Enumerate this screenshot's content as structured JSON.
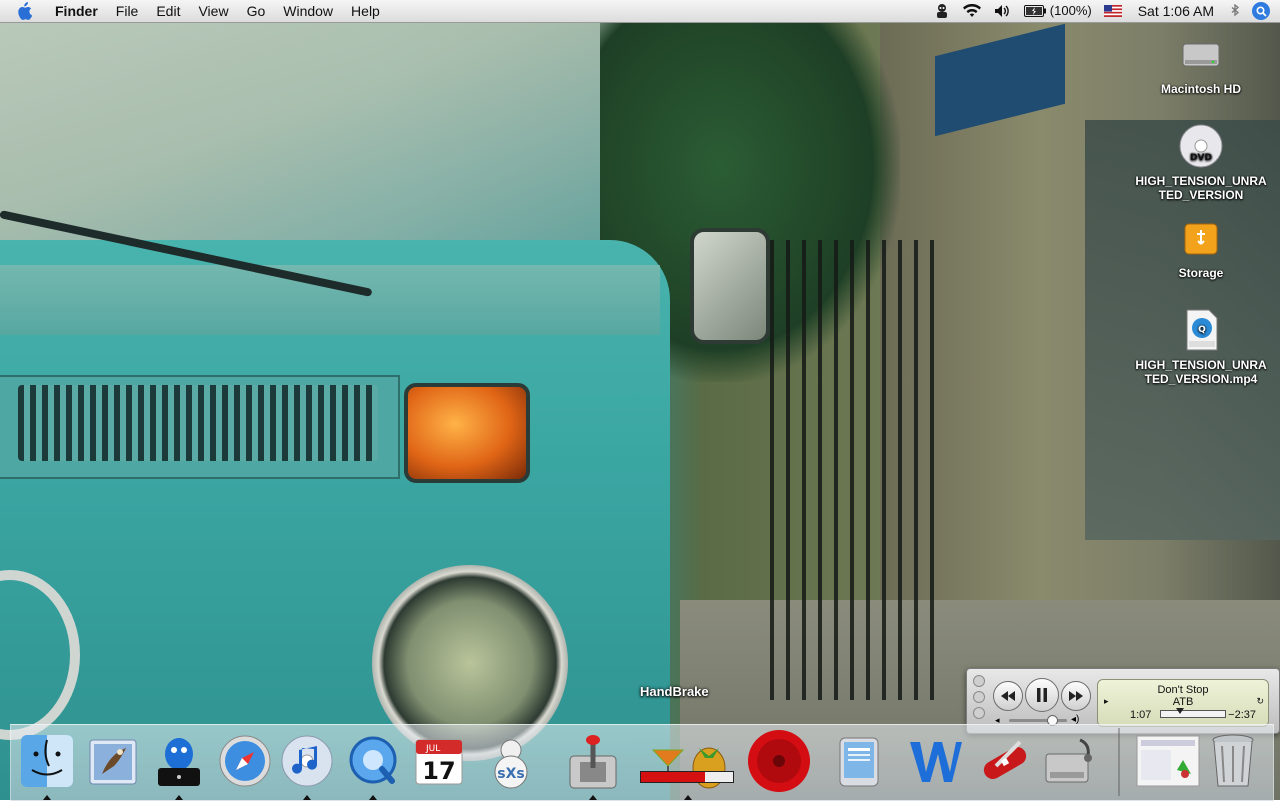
{
  "menubar": {
    "app_name": "Finder",
    "items": [
      "File",
      "Edit",
      "View",
      "Go",
      "Window",
      "Help"
    ],
    "status": {
      "battery_text": "(100%)",
      "clock": "Sat 1:06 AM"
    }
  },
  "desktop": {
    "icons": [
      {
        "label": "Macintosh HD",
        "icon": "hard-drive-icon"
      },
      {
        "label": "HIGH_TENSION_UNRATED_VERSION",
        "icon": "dvd-icon"
      },
      {
        "label": "Storage",
        "icon": "usb-drive-icon"
      },
      {
        "label": "HIGH_TENSION_UNRATED_VERSION.mp4",
        "icon": "mpeg4-file-icon"
      }
    ]
  },
  "itunes": {
    "song": "Don't Stop",
    "artist": "ATB",
    "elapsed": "1:07",
    "remaining": "−2:37",
    "progress": 0.3,
    "volume": 0.72
  },
  "dock": {
    "tooltip": "HandBrake",
    "handbrake_progress": 0.7,
    "items": [
      {
        "name": "finder-icon"
      },
      {
        "name": "mail-icon"
      },
      {
        "name": "adium-icon"
      },
      {
        "name": "safari-icon"
      },
      {
        "name": "itunes-icon"
      },
      {
        "name": "quicktime-icon"
      },
      {
        "name": "ical-icon",
        "month": "JUL",
        "day": "17"
      },
      {
        "name": "sxs-icon",
        "text": "sXs"
      },
      {
        "name": "handbrake-icon"
      },
      {
        "name": "cocktail-icon"
      },
      {
        "name": "disc-burn-icon"
      },
      {
        "name": "news-reader-icon"
      },
      {
        "name": "word-icon"
      },
      {
        "name": "swiss-knife-icon"
      },
      {
        "name": "disk-utility-icon"
      },
      {
        "name": "stack-icon"
      },
      {
        "name": "trash-icon"
      }
    ]
  },
  "colors": {
    "dock_progress_fill": "#d41010",
    "spotlight": "#2f7be0"
  }
}
